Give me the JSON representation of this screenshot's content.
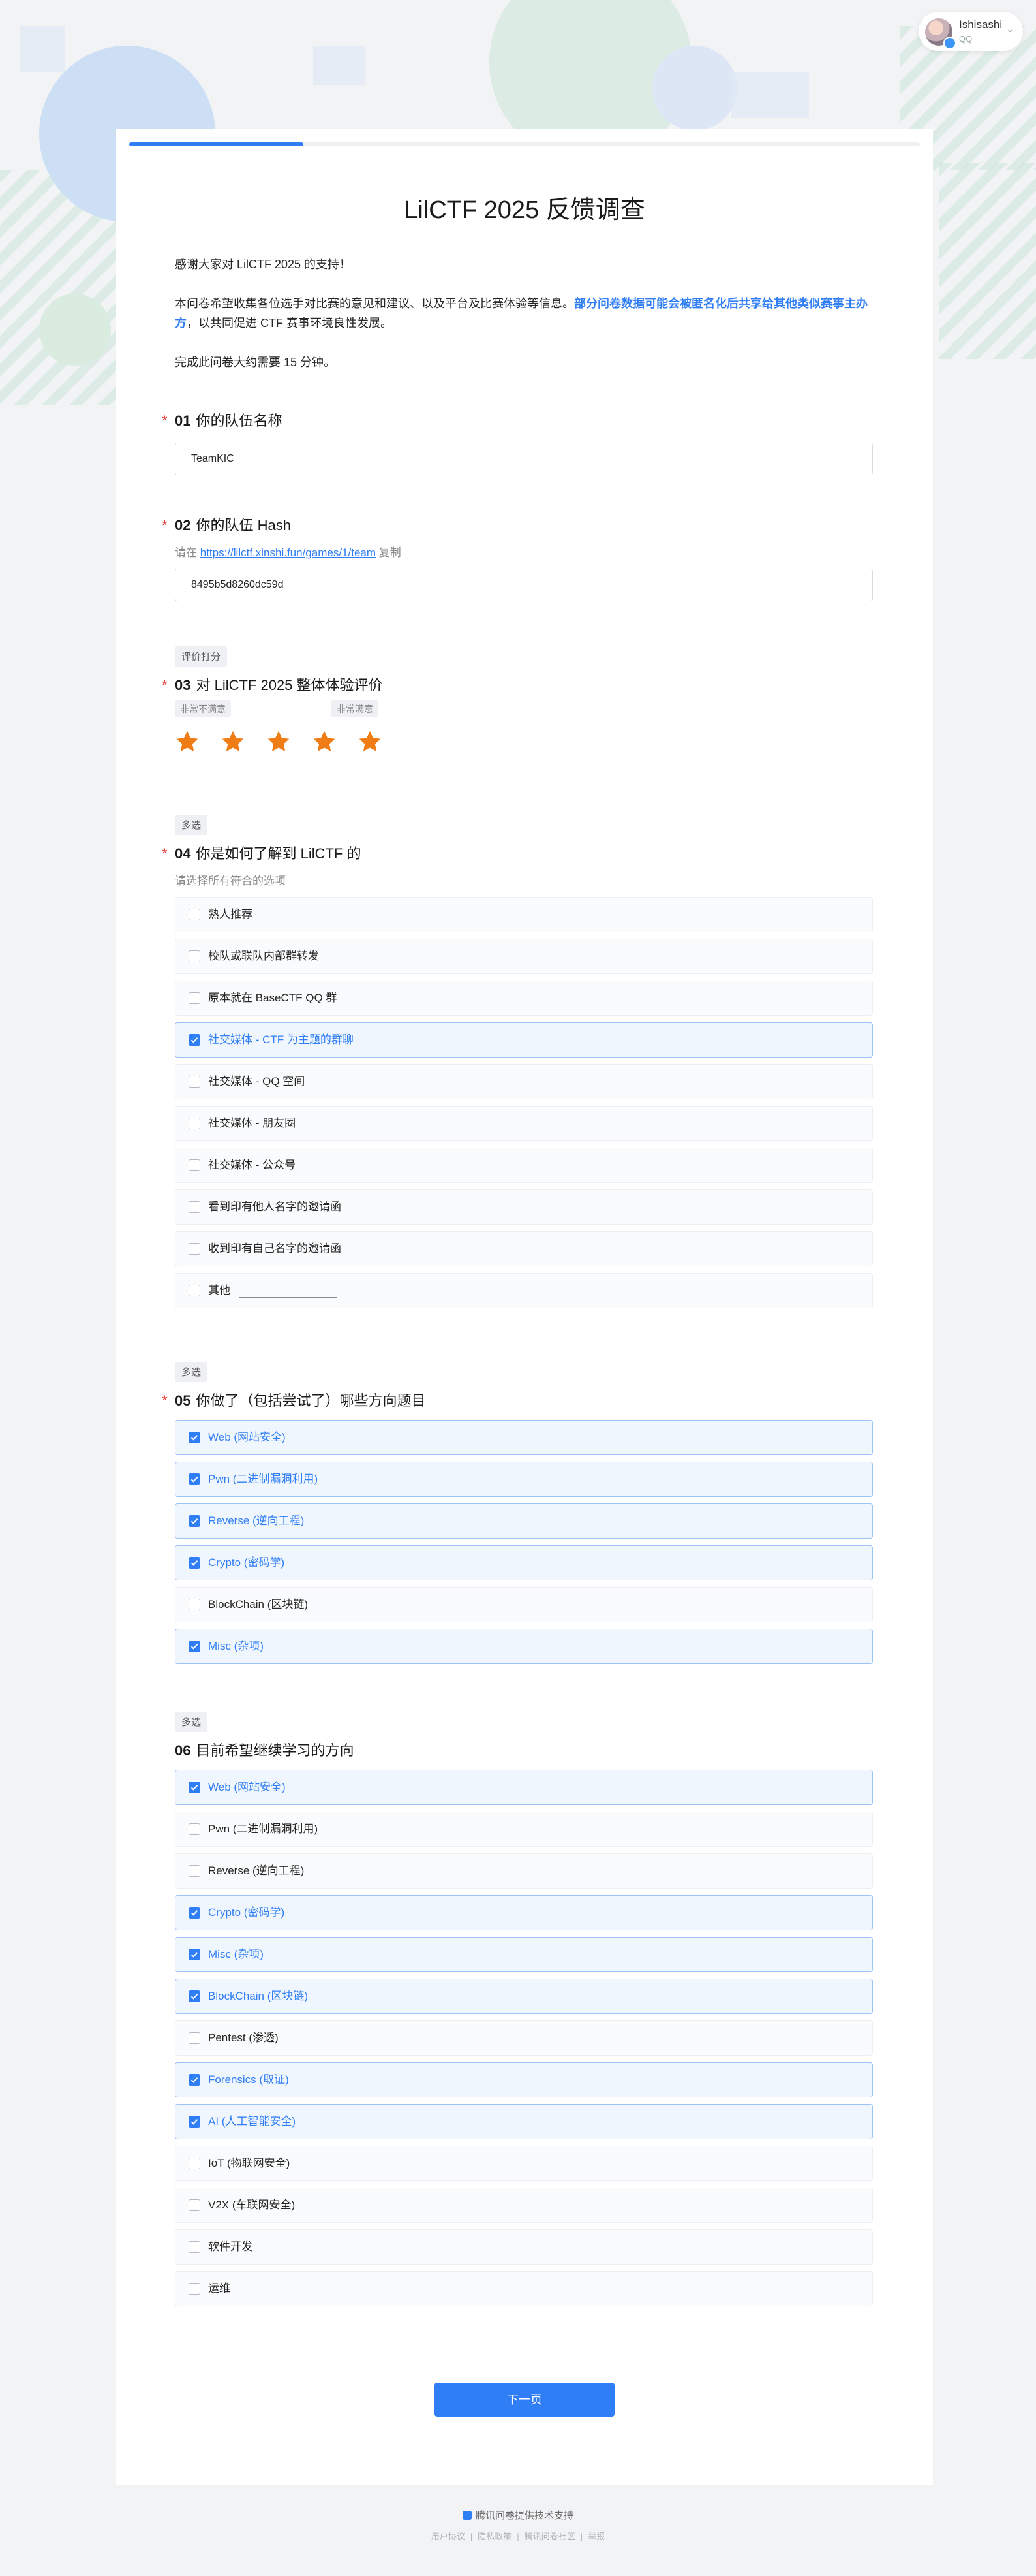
{
  "user": {
    "name": "Ishisashi",
    "sub": "QQ"
  },
  "progress": {
    "fraction": 0.22
  },
  "survey": {
    "title": "LilCTF 2025 反馈调查",
    "intro1": "感谢大家对 LilCTF 2025 的支持！",
    "intro2a": "本问卷希望收集各位选手对比赛的意见和建议、以及平台及比赛体验等信息。",
    "intro2b": "部分问卷数据可能会被匿名化后共享给其他类似赛事主办方",
    "intro2c": "，以共同促进 CTF 赛事环境良性发展。",
    "intro3": "完成此问卷大约需要 15 分钟。"
  },
  "q1": {
    "num": "01",
    "title": "你的队伍名称",
    "value": "TeamKIC"
  },
  "q2": {
    "num": "02",
    "title": "你的队伍 Hash",
    "desc_prefix": "请在 ",
    "link": "https://lilctf.xinshi.fun/games/1/team",
    "copy": " 复制",
    "value": "8495b5d8260dc59d"
  },
  "q3": {
    "tag": "评价打分",
    "num": "03",
    "title": "对 LilCTF 2025 整体体验评价",
    "low_label": "非常不满意",
    "high_label": "非常满意",
    "rating": 5,
    "max": 5,
    "star_color": "#f07c16"
  },
  "q4": {
    "tag": "多选",
    "num": "04",
    "title": "你是如何了解到 LilCTF 的",
    "desc": "请选择所有符合的选项",
    "options": [
      {
        "label": "熟人推荐",
        "checked": false
      },
      {
        "label": "校队或联队内部群转发",
        "checked": false
      },
      {
        "label": "原本就在 BaseCTF QQ 群",
        "checked": false
      },
      {
        "label": "社交媒体 - CTF 为主题的群聊",
        "checked": true
      },
      {
        "label": "社交媒体 - QQ 空间",
        "checked": false
      },
      {
        "label": "社交媒体 - 朋友圈",
        "checked": false
      },
      {
        "label": "社交媒体 - 公众号",
        "checked": false
      },
      {
        "label": "看到印有他人名字的邀请函",
        "checked": false
      },
      {
        "label": "收到印有自己名字的邀请函",
        "checked": false
      },
      {
        "label": "其他",
        "checked": false
      }
    ]
  },
  "q5": {
    "tag": "多选",
    "num": "05",
    "title": "你做了（包括尝试了）哪些方向题目",
    "options": [
      {
        "label": "Web (网站安全)",
        "checked": true
      },
      {
        "label": "Pwn (二进制漏洞利用)",
        "checked": true
      },
      {
        "label": "Reverse (逆向工程)",
        "checked": true
      },
      {
        "label": "Crypto (密码学)",
        "checked": true
      },
      {
        "label": "BlockChain (区块链)",
        "checked": false
      },
      {
        "label": "Misc (杂项)",
        "checked": true
      }
    ]
  },
  "q6": {
    "tag": "多选",
    "num": "06",
    "title": "目前希望继续学习的方向",
    "options": [
      {
        "label": "Web (网站安全)",
        "checked": true
      },
      {
        "label": "Pwn (二进制漏洞利用)",
        "checked": false
      },
      {
        "label": "Reverse (逆向工程)",
        "checked": false
      },
      {
        "label": "Crypto (密码学)",
        "checked": true
      },
      {
        "label": "Misc (杂项)",
        "checked": true
      },
      {
        "label": "BlockChain (区块链)",
        "checked": true
      },
      {
        "label": "Pentest (渗透)",
        "checked": false
      },
      {
        "label": "Forensics (取证)",
        "checked": true
      },
      {
        "label": "AI (人工智能安全)",
        "checked": true
      },
      {
        "label": "IoT (物联网安全)",
        "checked": false
      },
      {
        "label": "V2X (车联网安全)",
        "checked": false
      },
      {
        "label": "软件开发",
        "checked": false
      },
      {
        "label": "运维",
        "checked": false
      }
    ]
  },
  "next_label": "下一页",
  "footer": {
    "brand": "腾讯问卷提供技术支持",
    "links": [
      "用户协议",
      "隐私政策",
      "腾讯问卷社区",
      "举报"
    ]
  },
  "colors": {
    "accent": "#2f7ef5",
    "required": "#e53935"
  }
}
